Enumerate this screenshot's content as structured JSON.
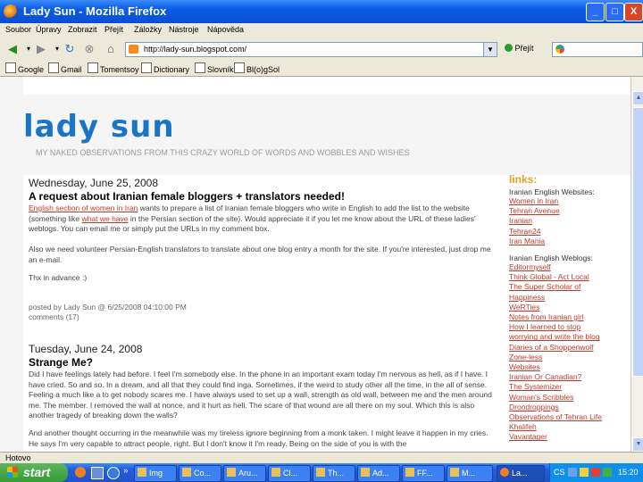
{
  "window": {
    "title": "Lady Sun - Mozilla Firefox",
    "buttons": [
      "_",
      "□",
      "X"
    ]
  },
  "menu": [
    "Soubor",
    "Úpravy",
    "Zobrazit",
    "Přejít",
    "Záložky",
    "Nástroje",
    "Nápověda"
  ],
  "nav": {
    "url": "http://lady-sun.blogspot.com/",
    "go_label": "Přejít"
  },
  "bookmarks": [
    "Google",
    "Gmail",
    "Tomentsoy",
    "Dictionary",
    "Slovník",
    "Bl(o)gSol"
  ],
  "blog": {
    "title": "lady sun",
    "description": "MY NAKED OBSERVATIONS FROM THIS CRAZY WORLD OF WORDS AND WOBBLES AND WISHES"
  },
  "posts": [
    {
      "date": "Wednesday, June 25, 2008",
      "title": "A request about Iranian female bloggers + translators needed!",
      "p1_link": "English section of women in Iran",
      "p1_a": " wants to prepare a list of Iranian female bloggers who write in English to add the list to the website (something like ",
      "p1_link2": "what we have",
      "p1_b": " in the Persian section of the site). Would appreciate it if you let me know about the URL of these ladies' weblogs. You can email me or simply put the URLs in my comment box.",
      "p2": "Also we need volunteer Persian-English translators to translate about one blog entry a month for the site. If you're interested, just drop me an e-mail.",
      "p3": "Thx in advance :)",
      "posted": "posted by Lady Sun @ 6/25/2008 04:10:00 PM",
      "comments": "comments (17)"
    },
    {
      "date": "Tuesday, June 24, 2008",
      "title": "Strange Me?",
      "p1": "Did I have feelings lately had before. I feel I'm somebody else. In the phone in an important exam today I'm nervous as hell, as if I have. I have cried. So and so. In a dream, and all that they could find inga. Sometimes, if the weird to study other all the time, in the all of sense. Feeling a much like a to get nobody scares me. I have always used to set up a wall, strength as old wall, between me and the men around me. The member. I removed the wall at nonce, and it hurt as hell. The scare of that wound are all there on my soul. Which this is also another tragedy of breaking down the walls?",
      "p2": "And another thought occurring in the meanwhile was my tireless ignore beginning from a monk taken. I might leave it happen in my cries. He says I'm very capable to attract people, right. But I don't know it I'm ready. Being on the side of you is with the"
    }
  ],
  "sidebar": {
    "heading": "links:",
    "groups": [
      {
        "title": "Iranian English Websites:",
        "links": [
          "Women in Iran",
          "Tehran Avenue",
          "Iranian",
          "Tehran24",
          "Iran Mania"
        ]
      },
      {
        "title": "Iranian English Weblogs:",
        "links": [
          "Editormyself",
          "Think Global - Act Local",
          "The Super Scholar of",
          "Happiness",
          "WeRTies",
          "Notes from Iranian girl",
          "How I learned to stop",
          "worrying and write the blog",
          "Diaries of a Shoppenwolf",
          "Zone-less",
          "Websites",
          "Iranian Or Canadian?",
          "The Systemizer",
          "Woman's Scribbles",
          "Droodroppings",
          "Observations of Tehran Life",
          "Khalifeh",
          "Vavantager"
        ]
      }
    ]
  },
  "status": "Hotovo",
  "taskbar": {
    "start": "start",
    "buttons": [
      "Img",
      "Co...",
      "Aru...",
      "Cl...",
      "Th...",
      "Ad...",
      "FF...",
      "M...",
      "La..."
    ],
    "lang": "CS",
    "clock": "15:20"
  }
}
